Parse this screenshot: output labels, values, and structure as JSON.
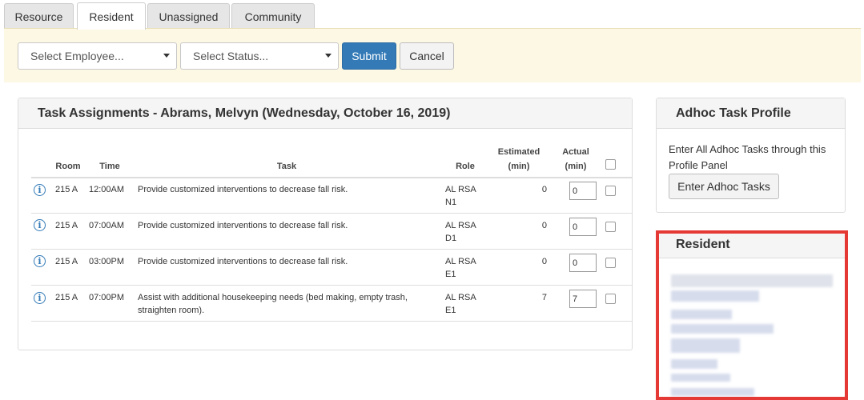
{
  "tabs": [
    {
      "label": "Resource",
      "active": false
    },
    {
      "label": "Resident",
      "active": true
    },
    {
      "label": "Unassigned",
      "active": false
    },
    {
      "label": "Community",
      "active": false
    }
  ],
  "filters": {
    "employee_placeholder": "Select Employee...",
    "status_placeholder": "Select Status...",
    "submit_label": "Submit",
    "cancel_label": "Cancel"
  },
  "tasks_panel": {
    "title": "Task Assignments - Abrams, Melvyn (Wednesday, October 16, 2019)",
    "columns": {
      "room": "Room",
      "time": "Time",
      "task": "Task",
      "role": "Role",
      "estimated": "Estimated\n(min)",
      "actual": "Actual\n(min)"
    },
    "rows": [
      {
        "room": "215 A",
        "time": "12:00AM",
        "task": "Provide customized interventions to decrease fall risk.",
        "role": "AL RSA\nN1",
        "estimated": "0",
        "actual": "0"
      },
      {
        "room": "215 A",
        "time": "07:00AM",
        "task": "Provide customized interventions to decrease fall risk.",
        "role": "AL RSA\nD1",
        "estimated": "0",
        "actual": "0"
      },
      {
        "room": "215 A",
        "time": "03:00PM",
        "task": "Provide customized interventions to decrease fall risk.",
        "role": "AL RSA\nE1",
        "estimated": "0",
        "actual": "0"
      },
      {
        "room": "215 A",
        "time": "07:00PM",
        "task": "Assist with additional housekeeping needs (bed making, empty trash, straighten room).",
        "role": "AL RSA\nE1",
        "estimated": "7",
        "actual": "7"
      }
    ]
  },
  "adhoc_panel": {
    "title": "Adhoc Task Profile",
    "text": "Enter All Adhoc Tasks through this Profile Panel",
    "button_label": "Enter Adhoc Tasks"
  },
  "resident_panel": {
    "title": "Resident"
  },
  "colors": {
    "primary": "#337ab7",
    "filter_bg": "#fcf8e3",
    "highlight": "#e53935"
  }
}
